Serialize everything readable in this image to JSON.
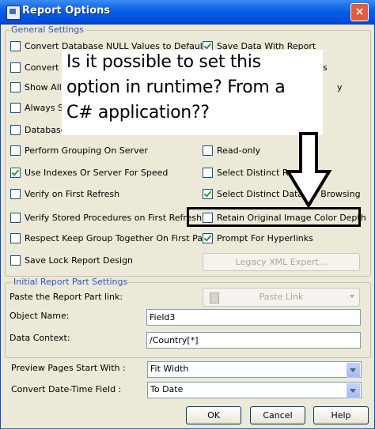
{
  "window": {
    "title": "Report Options",
    "close_label": "×"
  },
  "general": {
    "label": "General Settings",
    "left": [
      {
        "label": "Convert Database NULL Values to Default",
        "checked": false
      },
      {
        "label": "Convert O",
        "checked": false
      },
      {
        "label": "Show All H",
        "checked": false
      },
      {
        "label": "Always Sc",
        "checked": false
      },
      {
        "label": "Database",
        "checked": false
      },
      {
        "label": "Perform Grouping On Server",
        "checked": false
      },
      {
        "label": "Use Indexes Or Server For Speed",
        "checked": true
      },
      {
        "label": "Verify on First Refresh",
        "checked": false
      },
      {
        "label": "Verify Stored Procedures on First Refresh",
        "checked": false
      },
      {
        "label": "Respect Keep Group Together On First Page",
        "checked": false
      },
      {
        "label": "Save Lock Report Design",
        "checked": false
      }
    ],
    "right": [
      {
        "label": "Save Data With Report",
        "checked": true
      },
      {
        "label": "Read-only",
        "checked": false
      },
      {
        "label": "Select Distinct Record",
        "checked": false
      },
      {
        "label": "Select Distinct Data for Browsing",
        "checked": true
      },
      {
        "label": "Retain Original Image Color Depth",
        "checked": false
      },
      {
        "label": "Prompt For Hyperlinks",
        "checked": true
      }
    ],
    "right_fragments": {
      "row2": "s",
      "row3": "y"
    },
    "legacy_button": "Legacy XML Expert..."
  },
  "report_part": {
    "label": "Initial Report Part Settings",
    "paste_label": "Paste the Report Part link:",
    "paste_button": "Paste Link",
    "object_label": "Object Name:",
    "object_value": "Field3",
    "context_label": "Data Context:",
    "context_value": "/Country[*]"
  },
  "preview": {
    "label": "Preview Pages Start With :",
    "value": "Fit Width"
  },
  "datetime": {
    "label": "Convert Date-Time Field :",
    "value": "To Date"
  },
  "buttons": {
    "ok": "OK",
    "cancel": "Cancel",
    "help": "Help"
  },
  "overlay": {
    "lines": [
      "Is it possible to set this",
      "option in runtime? From a",
      "C# application??"
    ]
  },
  "icons": {
    "app": "report-app-icon",
    "paste": "clipboard-icon",
    "arrow": "down-arrow-icon"
  },
  "colors": {
    "group_label": "#2c55c7",
    "titlebar": "#0a5ee6",
    "check": "#21a121"
  }
}
